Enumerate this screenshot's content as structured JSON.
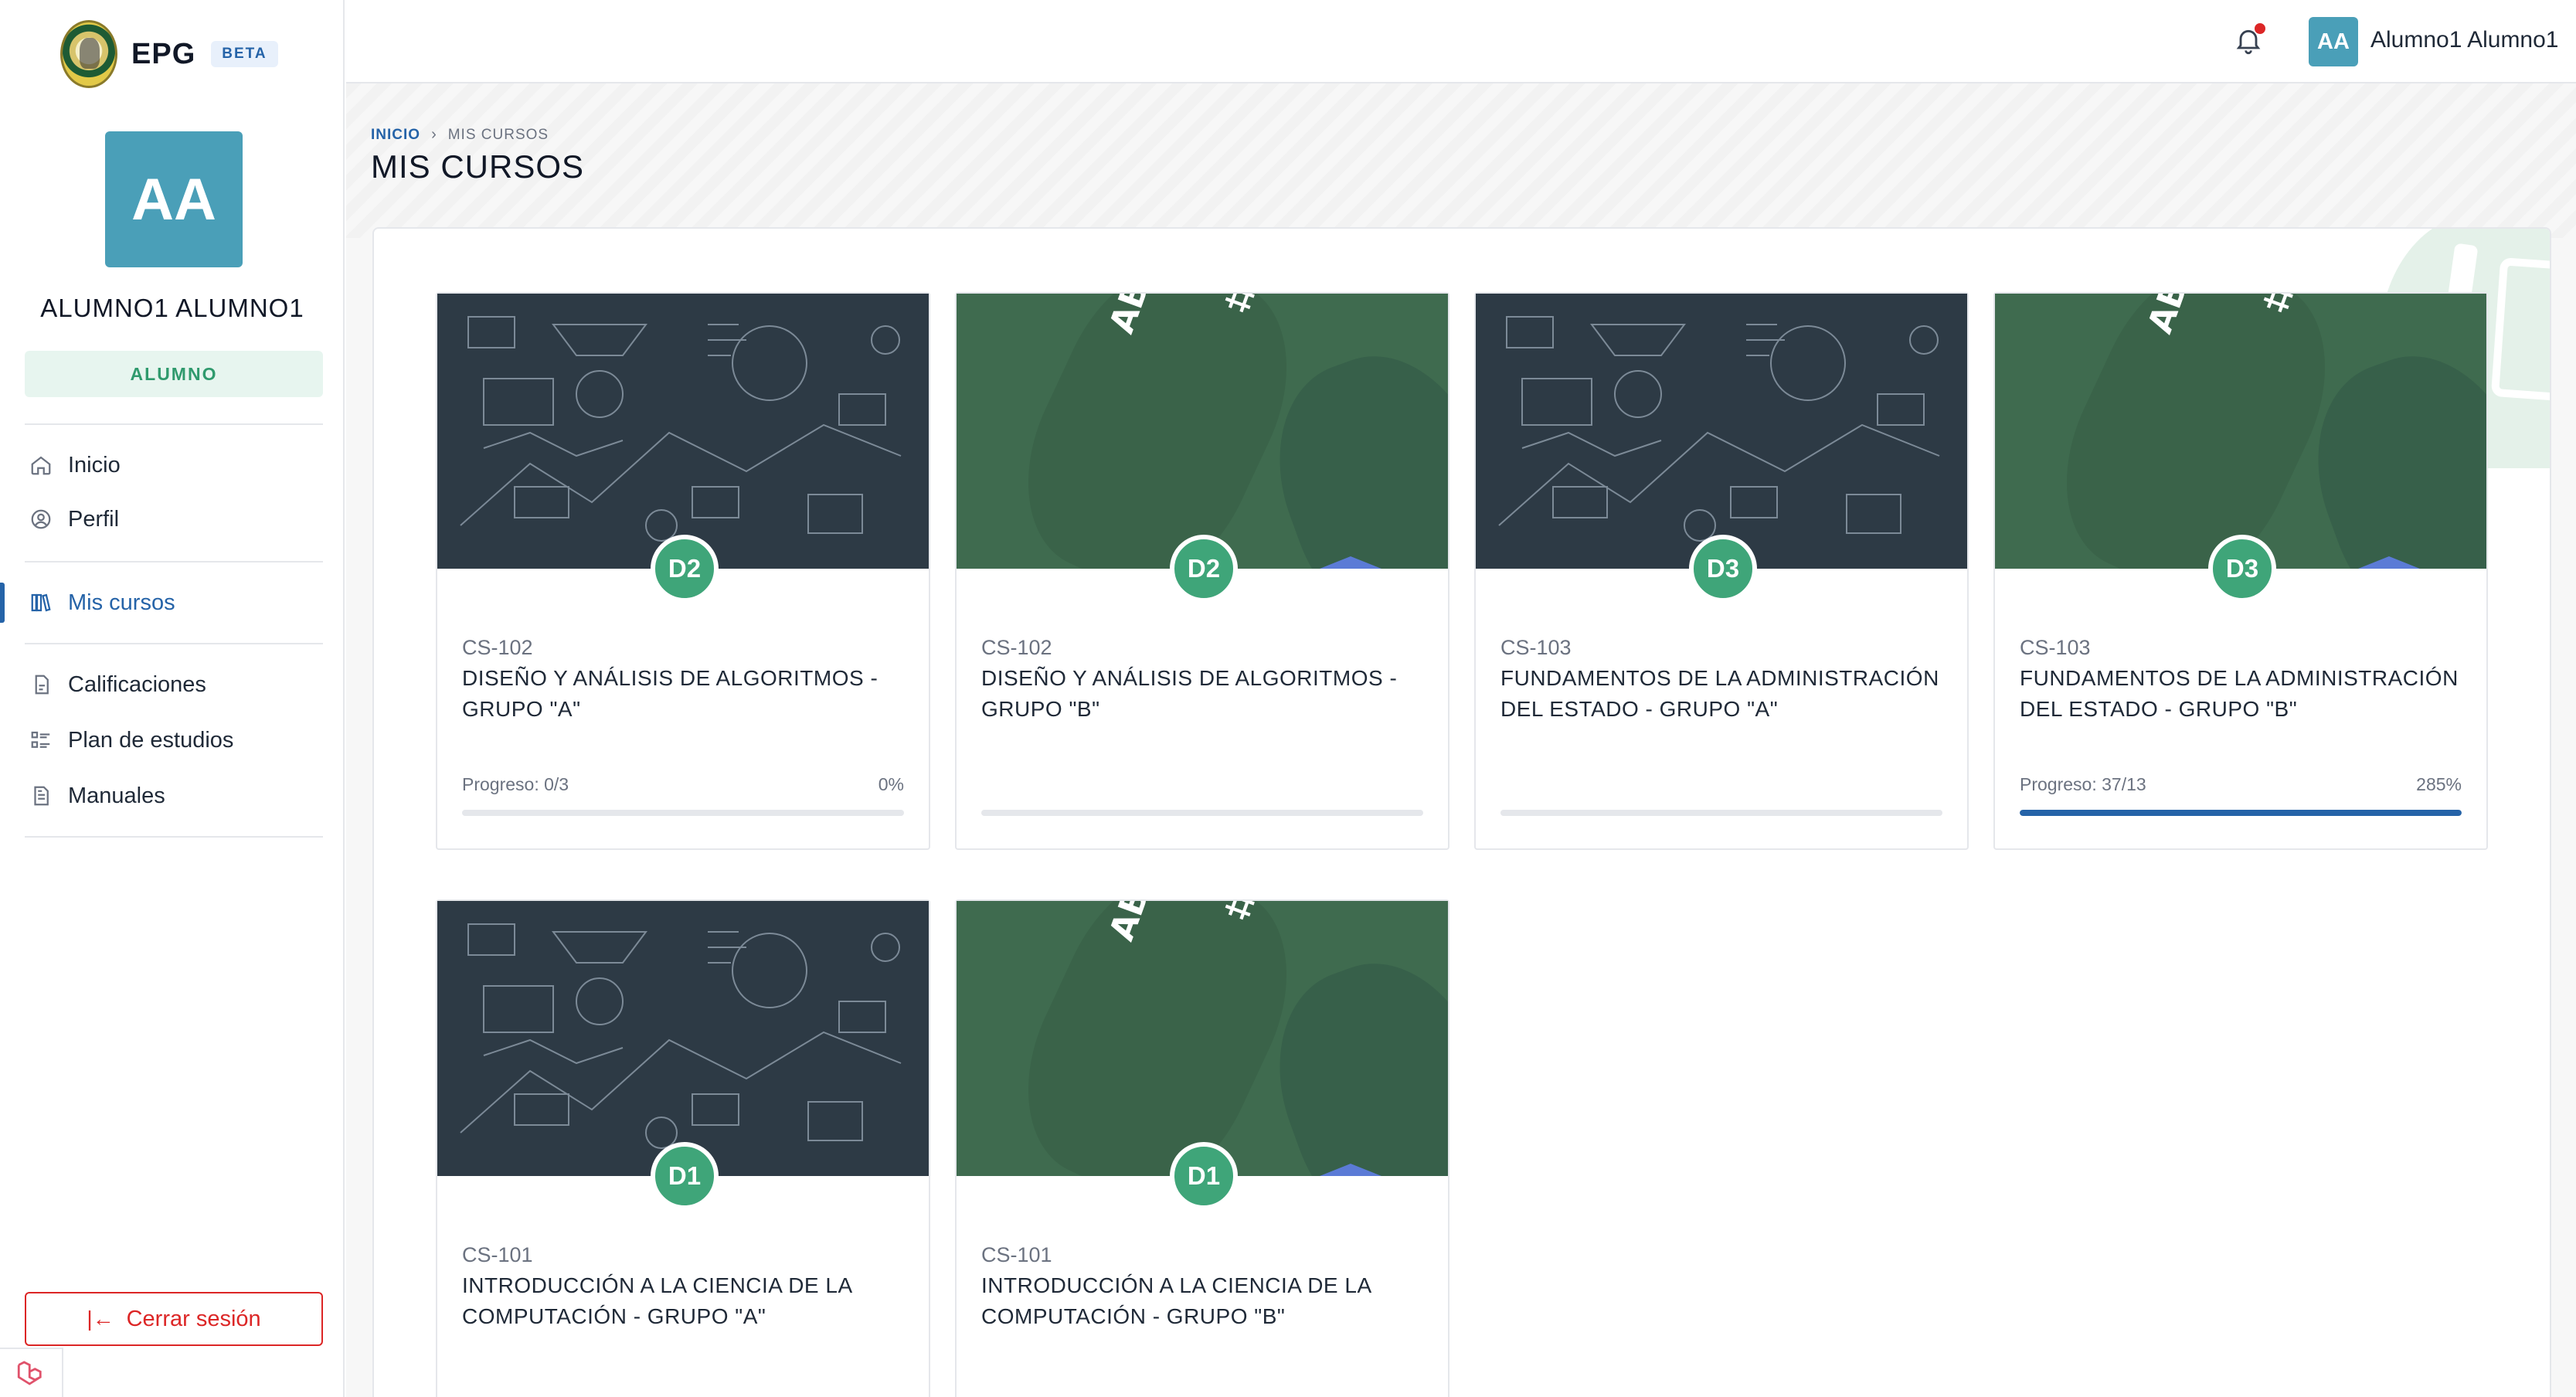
{
  "brand": {
    "name": "EPG",
    "badge": "BETA"
  },
  "user": {
    "initials": "AA",
    "display_name": "ALUMNO1 ALUMNO1",
    "role": "ALUMNO",
    "top_name": "Alumno1 Alumno1"
  },
  "nav": {
    "inicio": "Inicio",
    "perfil": "Perfil",
    "mis_cursos": "Mis cursos",
    "calificaciones": "Calificaciones",
    "plan": "Plan de estudios",
    "manuales": "Manuales"
  },
  "logout_label": "Cerrar sesión",
  "breadcrumb": {
    "home": "INICIO",
    "separator": "›",
    "current": "MIS CURSOS"
  },
  "page_title": "MIS CURSOS",
  "courses": [
    {
      "badge": "D2",
      "code": "CS-102",
      "name": "DISEÑO Y ANÁLISIS DE ALGORITMOS - GRUPO \"A\"",
      "progress_label": "Progreso: 0/3",
      "progress_pct_label": "0%",
      "progress_fraction": 0,
      "image": "tech-doodles"
    },
    {
      "badge": "D2",
      "code": "CS-102",
      "name": "DISEÑO Y ANÁLISIS DE ALGORITMOS - GRUPO \"B\"",
      "progress_label": "",
      "progress_pct_label": "",
      "progress_fraction": 0,
      "image": "green-school"
    },
    {
      "badge": "D3",
      "code": "CS-103",
      "name": "FUNDAMENTOS DE LA ADMINISTRACIÓN DEL ESTADO - GRUPO \"A\"",
      "progress_label": "",
      "progress_pct_label": "",
      "progress_fraction": 0,
      "image": "tech-doodles"
    },
    {
      "badge": "D3",
      "code": "CS-103",
      "name": "FUNDAMENTOS DE LA ADMINISTRACIÓN DEL ESTADO - GRUPO \"B\"",
      "progress_label": "Progreso: 37/13",
      "progress_pct_label": "285%",
      "progress_fraction": 1,
      "image": "green-school"
    },
    {
      "badge": "D1",
      "code": "CS-101",
      "name": "INTRODUCCIÓN A LA CIENCIA DE LA COMPUTACIÓN - GRUPO \"A\"",
      "progress_label": "",
      "progress_pct_label": "",
      "progress_fraction": 0,
      "image": "tech-doodles"
    },
    {
      "badge": "D1",
      "code": "CS-101",
      "name": "INTRODUCCIÓN A LA CIENCIA DE LA COMPUTACIÓN - GRUPO \"B\"",
      "progress_label": "",
      "progress_pct_label": "",
      "progress_fraction": 0,
      "image": "green-school"
    }
  ],
  "colors": {
    "primary": "#2563a8",
    "accent_green": "#3fa579",
    "avatar": "#4a9fb8",
    "danger": "#dc2626"
  },
  "icons": {
    "notifications": "bell-icon",
    "logout": "logout-arrow-icon"
  }
}
